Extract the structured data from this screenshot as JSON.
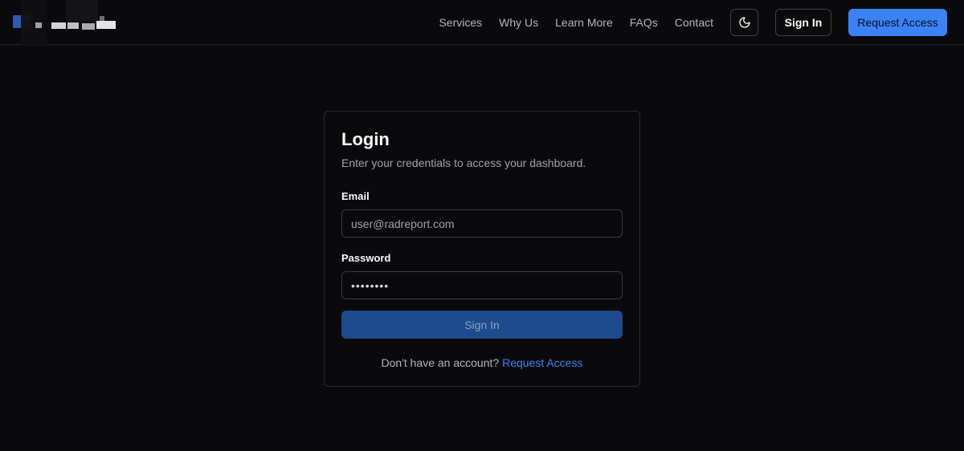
{
  "nav": {
    "links": [
      "Services",
      "Why Us",
      "Learn More",
      "FAQs",
      "Contact"
    ],
    "theme_icon": "moon-icon",
    "sign_in_label": "Sign In",
    "request_access_label": "Request Access"
  },
  "login": {
    "title": "Login",
    "subtitle": "Enter your credentials to access your dashboard.",
    "email_label": "Email",
    "email_placeholder": "user@radreport.com",
    "password_label": "Password",
    "password_value": "••••••••",
    "submit_label": "Sign In",
    "footer_text": "Don't have an account?",
    "footer_link": "Request Access"
  },
  "colors": {
    "background": "#0a0a0c",
    "accent": "#3b82f6",
    "submit_bg": "#1e4a8e",
    "border": "#2a2a30"
  }
}
